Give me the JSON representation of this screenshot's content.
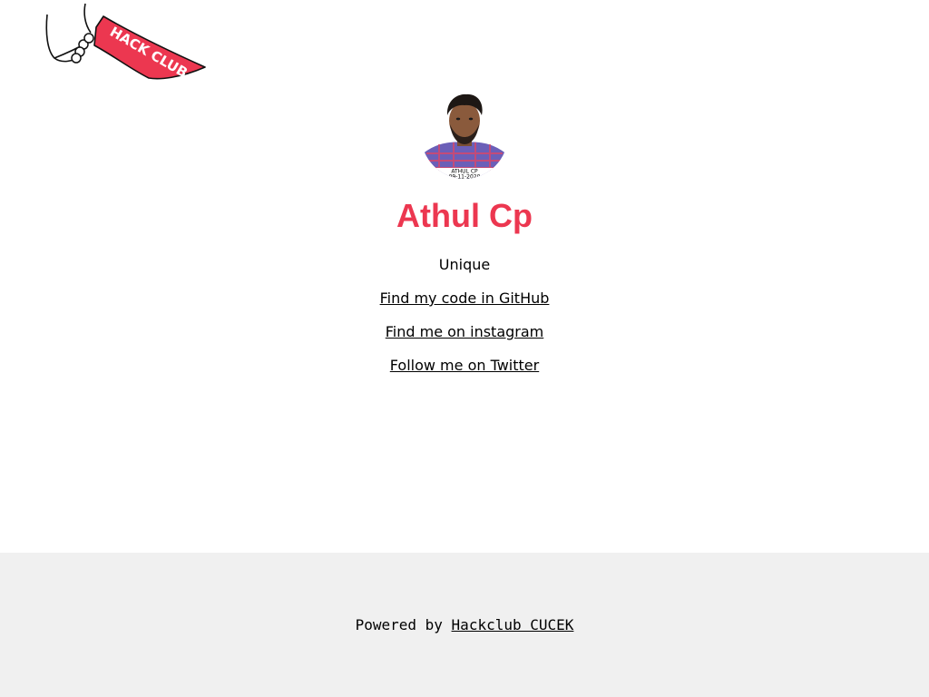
{
  "brand": {
    "logo_text": "HACK CLUB",
    "accent_color": "#ec3750"
  },
  "profile": {
    "photo_caption_name": "ATHUL CP",
    "photo_caption_date": "09-11-2020",
    "name": "Athul Cp",
    "tagline": "Unique"
  },
  "links": [
    {
      "label": "Find my code in GitHub"
    },
    {
      "label": "Find me on instagram"
    },
    {
      "label": "Follow me on Twitter"
    }
  ],
  "footer": {
    "prefix": "Powered by",
    "link_label": "Hackclub CUCEK",
    "background": "#f0f0f0"
  }
}
